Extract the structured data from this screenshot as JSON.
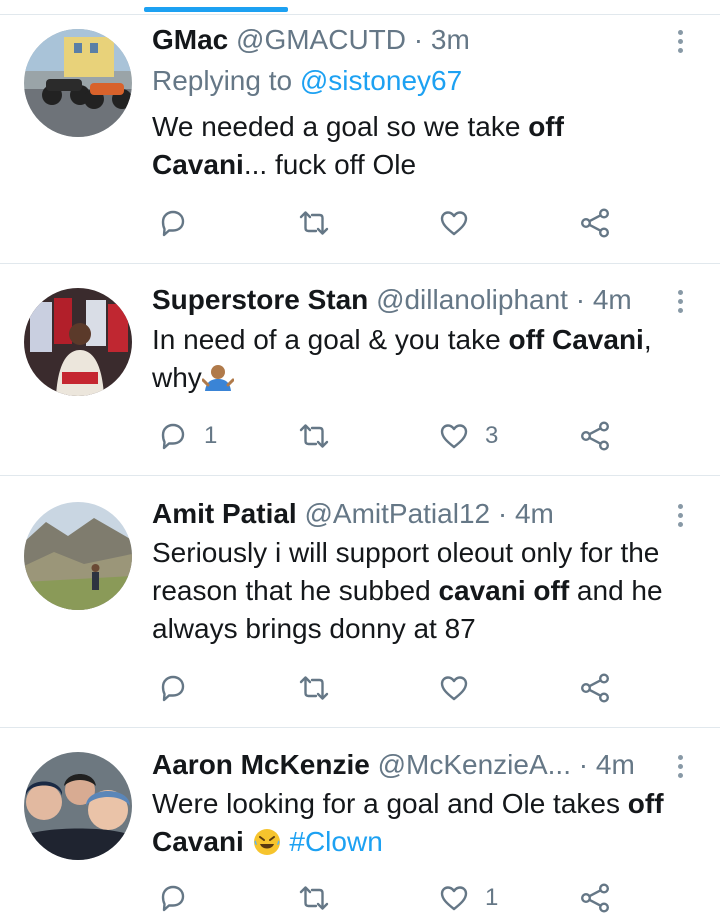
{
  "tweets": [
    {
      "name": "GMac",
      "handle": "@GMACUTD",
      "dot": "·",
      "time": "3m",
      "replying_prefix": "Replying to",
      "replying_to": "@sistoney67",
      "body": {
        "t1": "We needed a goal so we take ",
        "b1": "off",
        "b2": "Cavani",
        "t2": "... fuck off Ole"
      },
      "reply_count": "",
      "retweet_count": "",
      "like_count": ""
    },
    {
      "name": "Superstore Stan",
      "handle": "@dillanoliphant",
      "dot": "·",
      "time": "4m",
      "body": {
        "t1": "In need of a goal & you take ",
        "b1": "off Cavani",
        "t2": ", why",
        "emoji": "person-shrugging-emoji"
      },
      "reply_count": "1",
      "retweet_count": "",
      "like_count": "3"
    },
    {
      "name": "Amit Patial",
      "handle": "@AmitPatial12",
      "dot": "·",
      "time": "4m",
      "body": {
        "t1": "Seriously i will support oleout only for the reason that he subbed ",
        "b1": "cavani off",
        "t2": " and he always brings donny at 87"
      },
      "reply_count": "",
      "retweet_count": "",
      "like_count": ""
    },
    {
      "name": "Aaron McKenzie",
      "handle": "@McKenzieA...",
      "dot": "·",
      "time": "4m",
      "body": {
        "t1": "Were looking for a goal and Ole takes ",
        "b1": "off",
        "b2": "Cavani",
        "emoji": "rolling-on-floor-laughing-emoji",
        "hashtag": "#Clown"
      },
      "reply_count": "",
      "retweet_count": "",
      "like_count": "1"
    }
  ],
  "icons": {
    "reply": "reply-icon",
    "retweet": "retweet-icon",
    "like": "heart-icon",
    "share": "share-icon",
    "more": "more-vertical-icon"
  },
  "colors": {
    "accent": "#1da1f2",
    "secondary_text": "#657786",
    "icon": "#657786",
    "divider": "#e1e8ed"
  }
}
